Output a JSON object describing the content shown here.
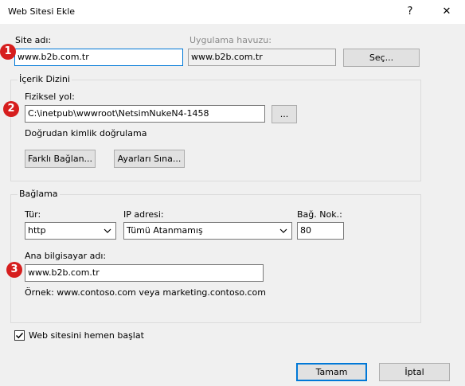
{
  "window": {
    "title": "Web Sitesi Ekle",
    "help": "?",
    "close": "✕"
  },
  "site": {
    "name_label": "Site adı:",
    "name_value": "www.b2b.com.tr",
    "pool_label": "Uygulama havuzu:",
    "pool_value": "www.b2b.com.tr",
    "select_button": "Seç..."
  },
  "content": {
    "legend": "İçerik Dizini",
    "path_label": "Fiziksel yol:",
    "path_value": "C:\\inetpub\\wwwroot\\NetsimNukeN4-1458",
    "browse_button": "...",
    "auth_text": "Doğrudan kimlik doğrulama",
    "connect_as_button": "Farklı Bağlan...",
    "test_settings_button": "Ayarları Sına..."
  },
  "binding": {
    "legend": "Bağlama",
    "type_label": "Tür:",
    "type_value": "http",
    "ip_label": "IP adresi:",
    "ip_value": "Tümü Atanmamış",
    "port_label": "Bağ. Nok.:",
    "port_value": "80",
    "host_label": "Ana bilgisayar adı:",
    "host_value": "www.b2b.com.tr",
    "example": "Örnek: www.contoso.com veya marketing.contoso.com"
  },
  "start": {
    "label": "Web sitesini hemen başlat",
    "checked": true
  },
  "footer": {
    "ok": "Tamam",
    "cancel": "İptal"
  },
  "badges": [
    "1",
    "2",
    "3"
  ]
}
